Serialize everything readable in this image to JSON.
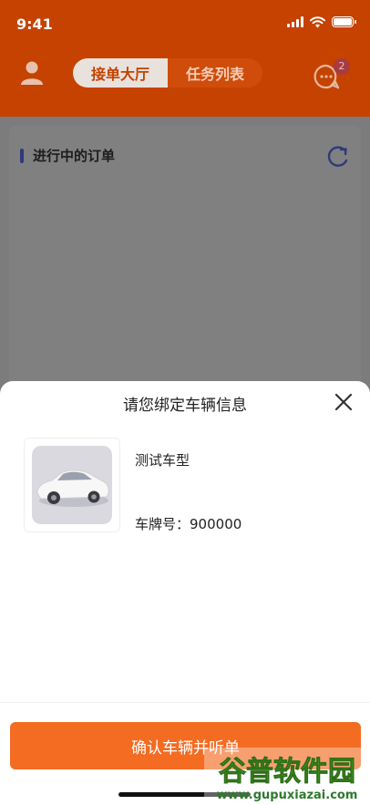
{
  "status_bar": {
    "time": "9:41"
  },
  "header": {
    "tabs": [
      {
        "label": "接单大厅",
        "active": true
      },
      {
        "label": "任务列表",
        "active": false
      }
    ],
    "message_badge": "2"
  },
  "content": {
    "section_title": "进行中的订单"
  },
  "sheet": {
    "title": "请您绑定车辆信息",
    "vehicle": {
      "model": "测试车型",
      "plate_label": "车牌号：",
      "plate_number": "900000"
    },
    "confirm_label": "确认车辆并听单"
  },
  "watermark": {
    "title": "谷普软件园",
    "url": "www.gupuxiazai.com"
  },
  "colors": {
    "brand_orange": "#f36c22",
    "header_bg": "#c64200",
    "accent_blue": "#303a7a"
  }
}
